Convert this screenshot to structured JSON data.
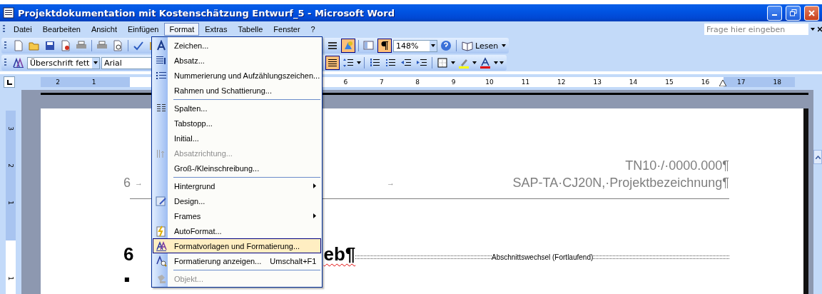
{
  "window": {
    "title": "Projektdokumentation mit Kostenschätzung Entwurf_5 - Microsoft Word"
  },
  "menu_bar": {
    "items": [
      {
        "label": "Datei",
        "selected": false
      },
      {
        "label": "Bearbeiten",
        "selected": false
      },
      {
        "label": "Ansicht",
        "selected": false
      },
      {
        "label": "Einfügen",
        "selected": false
      },
      {
        "label": "Format",
        "selected": true
      },
      {
        "label": "Extras",
        "selected": false
      },
      {
        "label": "Tabelle",
        "selected": false
      },
      {
        "label": "Fenster",
        "selected": false
      },
      {
        "label": "?",
        "selected": false
      }
    ],
    "help_box": {
      "placeholder": "Frage hier eingeben"
    }
  },
  "standard_toolbar": {
    "drawing_pressed": true,
    "formatting_marks_pressed": true,
    "zoom": "148%",
    "read_button": "Lesen"
  },
  "formatting_toolbar": {
    "style": "Überschrift fett",
    "font": "Arial",
    "justify_pressed": true
  },
  "ruler": {
    "left_labels": [
      "2",
      "1"
    ],
    "right_labels": [
      "6",
      "7",
      "8",
      "9",
      "10",
      "11",
      "12",
      "13",
      "14",
      "15",
      "16",
      "17",
      "18"
    ]
  },
  "vertical_ruler": {
    "labels": [
      "3",
      "2",
      "1",
      "1"
    ]
  },
  "format_menu": {
    "items": [
      {
        "label": "Zeichen...",
        "disabled": false,
        "selected": false,
        "separator_before": false,
        "submenu": false
      },
      {
        "label": "Absatz...",
        "disabled": false,
        "selected": false,
        "separator_before": false,
        "submenu": false
      },
      {
        "label": "Nummerierung und Aufzählungszeichen...",
        "disabled": false,
        "selected": false,
        "separator_before": false,
        "submenu": false
      },
      {
        "label": "Rahmen und Schattierung...",
        "disabled": false,
        "selected": false,
        "separator_before": false,
        "submenu": false
      },
      {
        "label": "Spalten...",
        "disabled": false,
        "selected": false,
        "separator_before": true,
        "submenu": false
      },
      {
        "label": "Tabstopp...",
        "disabled": false,
        "selected": false,
        "separator_before": false,
        "submenu": false
      },
      {
        "label": "Initial...",
        "disabled": false,
        "selected": false,
        "separator_before": false,
        "submenu": false
      },
      {
        "label": "Absatzrichtung...",
        "disabled": true,
        "selected": false,
        "separator_before": false,
        "submenu": false
      },
      {
        "label": "Groß-/Kleinschreibung...",
        "disabled": false,
        "selected": false,
        "separator_before": false,
        "submenu": false
      },
      {
        "label": "Hintergrund",
        "disabled": false,
        "selected": false,
        "separator_before": true,
        "submenu": true
      },
      {
        "label": "Design...",
        "disabled": false,
        "selected": false,
        "separator_before": false,
        "submenu": false
      },
      {
        "label": "Frames",
        "disabled": false,
        "selected": false,
        "separator_before": false,
        "submenu": true
      },
      {
        "label": "AutoFormat...",
        "disabled": false,
        "selected": false,
        "separator_before": false,
        "submenu": false
      },
      {
        "label": "Formatvorlagen und Formatierung...",
        "disabled": false,
        "selected": true,
        "separator_before": false,
        "submenu": false
      },
      {
        "label": "Formatierung anzeigen...",
        "shortcut": "Umschalt+F1",
        "disabled": false,
        "selected": false,
        "separator_before": false,
        "submenu": false
      },
      {
        "label": "Objekt...",
        "disabled": true,
        "selected": false,
        "separator_before": true,
        "submenu": false
      }
    ]
  },
  "document": {
    "header": {
      "page_number": "6",
      "tab_marks": [
        "→",
        "→"
      ],
      "lines": [
        "TN10·/·0000.000¶",
        "SAP-TA·CJ20N,·Projektbezeichnung¶"
      ]
    },
    "heading": {
      "number": "6",
      "visible_tail": "eb¶"
    },
    "section_break": "Abschnittswechsel (Fortlaufend)",
    "bullet": "■"
  }
}
